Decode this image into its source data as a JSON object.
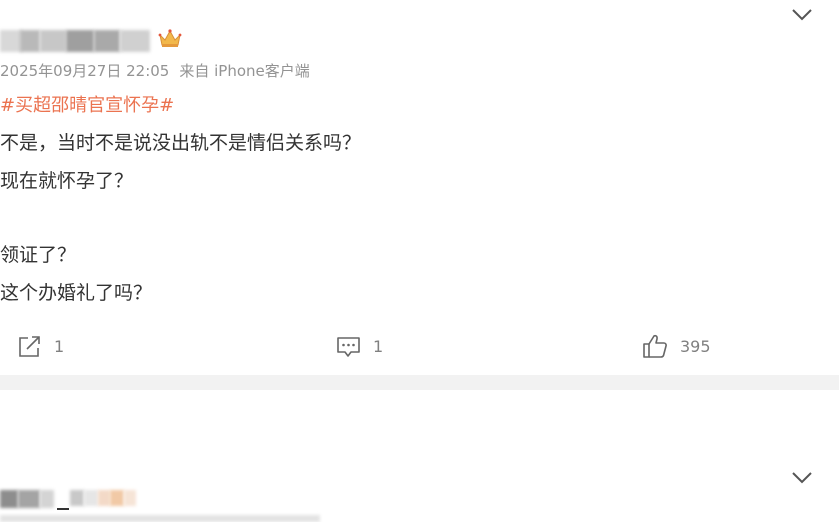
{
  "post": {
    "timestamp": "2025年09月27日 22:05",
    "source": "来自 iPhone客户端",
    "topic": "#买超邵晴官宣怀孕#",
    "lines": [
      "不是，当时不是说没出轨不是情侣关系吗？",
      "现在就怀孕了？",
      "领证了？",
      "这个办婚礼了吗？"
    ]
  },
  "actions": {
    "share_count": "1",
    "comment_count": "1",
    "like_count": "395"
  },
  "colors": {
    "topic": "#eb7350",
    "meta_text": "#939393",
    "body_text": "#333333",
    "divider": "#f2f2f2",
    "crown": "#f2b84b"
  },
  "icons": {
    "expand": "chevron-down-icon",
    "crown": "crown-badge-icon",
    "share": "share-icon",
    "comment": "comment-icon",
    "like": "thumbs-up-icon"
  }
}
